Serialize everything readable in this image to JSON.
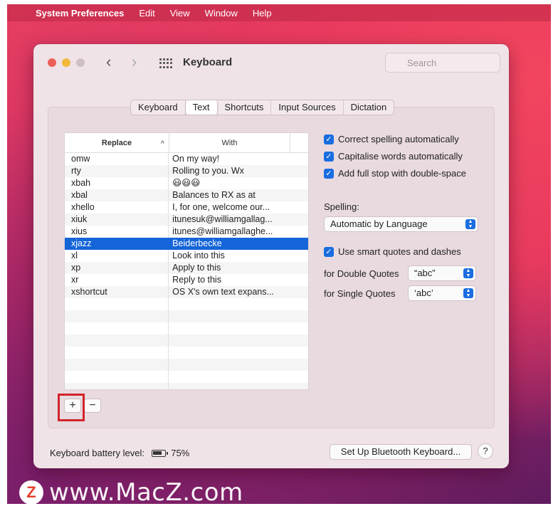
{
  "menubar": {
    "apple_icon": "apple-logo-icon",
    "items": [
      "System Preferences",
      "Edit",
      "View",
      "Window",
      "Help"
    ]
  },
  "window": {
    "title": "Keyboard",
    "search_placeholder": "Search"
  },
  "tabs": [
    {
      "label": "Keyboard",
      "active": false
    },
    {
      "label": "Text",
      "active": true
    },
    {
      "label": "Shortcuts",
      "active": false
    },
    {
      "label": "Input Sources",
      "active": false
    },
    {
      "label": "Dictation",
      "active": false
    }
  ],
  "table": {
    "headers": {
      "replace": "Replace",
      "with": "With"
    },
    "sort_indicator": "^",
    "rows": [
      {
        "replace": "omw",
        "with": "On my way!",
        "selected": false
      },
      {
        "replace": "rty",
        "with": "Rolling to you. Wx",
        "selected": false
      },
      {
        "replace": "xbah",
        "with": "😃😃😃",
        "selected": false
      },
      {
        "replace": "xbal",
        "with": "Balances to RX as at",
        "selected": false
      },
      {
        "replace": "xhello",
        "with": "I, for one, welcome our...",
        "selected": false
      },
      {
        "replace": "xiuk",
        "with": "itunesuk@williamgallag...",
        "selected": false
      },
      {
        "replace": "xius",
        "with": "itunes@williamgallaghe...",
        "selected": false
      },
      {
        "replace": "xjazz",
        "with": "Beiderbecke",
        "selected": true
      },
      {
        "replace": "xl",
        "with": "Look into this",
        "selected": false
      },
      {
        "replace": "xp",
        "with": "Apply to this",
        "selected": false
      },
      {
        "replace": "xr",
        "with": "Reply to this",
        "selected": false
      },
      {
        "replace": "xshortcut",
        "with": "OS X's own text expans...",
        "selected": false
      }
    ],
    "add_label": "+",
    "remove_label": "−"
  },
  "options": {
    "correct_spelling": "Correct spelling automatically",
    "capitalise_words": "Capitalise words automatically",
    "full_stop": "Add full stop with double-space",
    "spelling_label": "Spelling:",
    "spelling_value": "Automatic by Language",
    "smart_quotes": "Use smart quotes and dashes",
    "double_quotes_label": "for Double Quotes",
    "double_quotes_value": "“abc”",
    "single_quotes_label": "for Single Quotes",
    "single_quotes_value": "‘abc’",
    "check_mark": "✓"
  },
  "footer": {
    "battery_label": "Keyboard battery level:",
    "battery_value": "75%",
    "bluetooth_button": "Set Up Bluetooth Keyboard...",
    "help_button": "?"
  },
  "watermark": {
    "logo_letter": "Z",
    "text": "www.MacZ.com"
  },
  "colors": {
    "accent": "#1a6de0",
    "selection": "#1565d8",
    "highlight_box": "#d2232a"
  }
}
